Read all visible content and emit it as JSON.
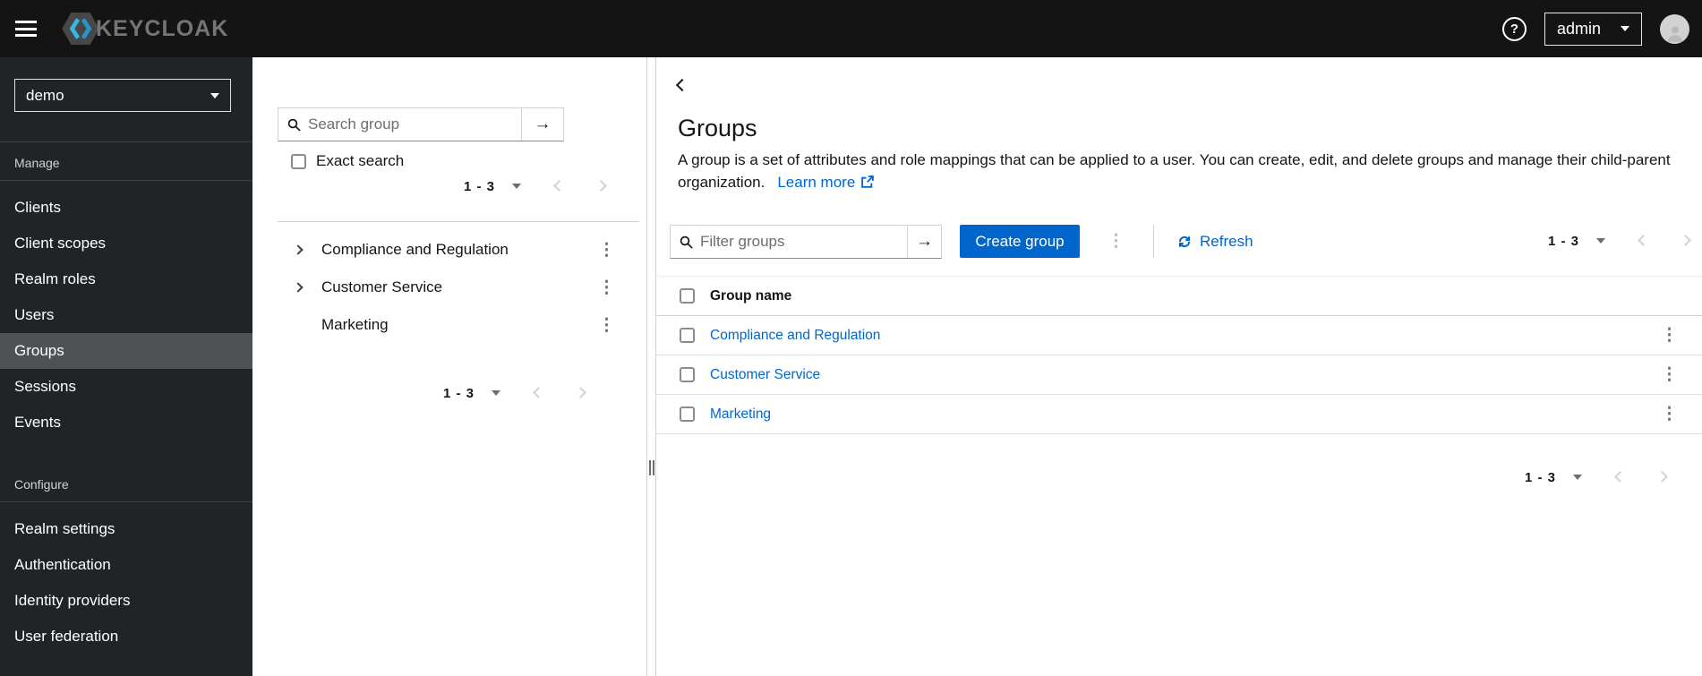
{
  "masthead": {
    "brand": "KEYCLOAK",
    "user": "admin"
  },
  "sidebar": {
    "realm": "demo",
    "sections": [
      {
        "title": "Manage",
        "items": [
          {
            "label": "Clients"
          },
          {
            "label": "Client scopes"
          },
          {
            "label": "Realm roles"
          },
          {
            "label": "Users"
          },
          {
            "label": "Groups"
          },
          {
            "label": "Sessions"
          },
          {
            "label": "Events"
          }
        ]
      },
      {
        "title": "Configure",
        "items": [
          {
            "label": "Realm settings"
          },
          {
            "label": "Authentication"
          },
          {
            "label": "Identity providers"
          },
          {
            "label": "User federation"
          }
        ]
      }
    ],
    "active_item": "Groups"
  },
  "groups_tree": {
    "search_placeholder": "Search group",
    "exact_search_label": "Exact search",
    "pagination_top": "1 - 3",
    "pagination_bottom": "1 - 3",
    "items": [
      {
        "label": "Compliance and Regulation",
        "expandable": true
      },
      {
        "label": "Customer Service",
        "expandable": true
      },
      {
        "label": "Marketing",
        "expandable": false
      }
    ]
  },
  "main": {
    "title": "Groups",
    "description": "A group is a set of attributes and role mappings that can be applied to a user. You can create, edit, and delete groups and manage their child-parent organization.",
    "learn_more_label": "Learn more",
    "toolbar": {
      "filter_placeholder": "Filter groups",
      "create_label": "Create group",
      "refresh_label": "Refresh",
      "pagination": "1 - 3"
    },
    "table": {
      "header": "Group name",
      "rows": [
        {
          "name": "Compliance and Regulation"
        },
        {
          "name": "Customer Service"
        },
        {
          "name": "Marketing"
        }
      ]
    },
    "pagination_bottom": "1 - 3"
  },
  "colors": {
    "primary": "#0066cc",
    "link": "#0066cc",
    "masthead_bg": "#141414",
    "sidebar_bg": "#212427",
    "sidebar_active_bg": "#4f5255",
    "border": "#d2d2d2"
  }
}
